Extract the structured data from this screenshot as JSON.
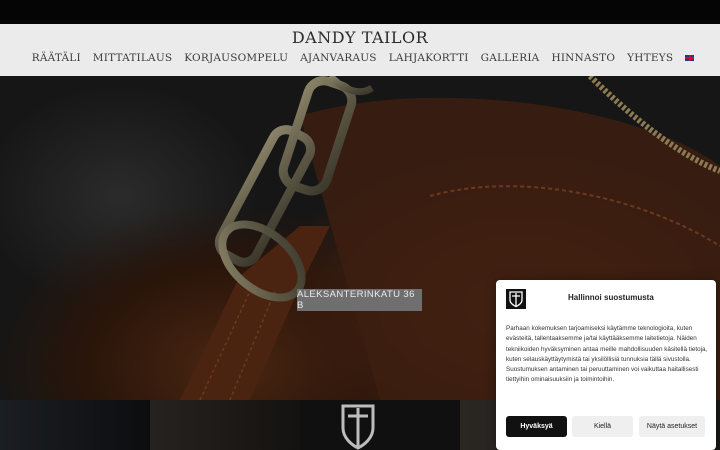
{
  "site": {
    "title": "DANDY TAILOR"
  },
  "nav": {
    "items": [
      "RÄÄTÄLI",
      "MITTATILAUS",
      "KORJAUSOMPELU",
      "AJANVARAUS",
      "LAHJAKORTTI",
      "GALLERIA",
      "HINNASTO",
      "YHTEYS"
    ],
    "language_icon": "uk-flag-icon"
  },
  "hero": {
    "address_label": "ALEKSANTERINKATU 36 B"
  },
  "consent": {
    "logo_icon": "dandy-tailor-shield-icon",
    "title": "Hallinnoi suostumusta",
    "text": "Parhaan kokemuksen tarjoamiseksi käytämme teknologioita, kuten evästeitä, tallentaaksemme ja/tai käyttääksemme laitetietoja. Näiden tekniikoiden hyväksyminen antaa meille mahdollisuuden käsitellä tietoja, kuten selauskäyttäytymistä tai yksilöllisiä tunnuksia tällä sivustolla. Suostumuksen antaminen tai peruuttaminen voi vaikuttaa haitallisesti tiettyihin ominaisuuksiin ja toimintoihin.",
    "accept_label": "Hyväksyä",
    "deny_label": "Kiellä",
    "settings_label": "Näytä asetukset"
  },
  "colors": {
    "header_bg": "#ebebeb",
    "accent_dark": "#111111",
    "address_bg": "#6f6f6f"
  }
}
